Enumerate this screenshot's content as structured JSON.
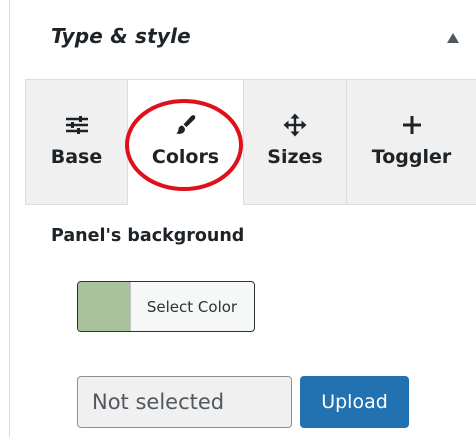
{
  "panel": {
    "title": "Type & style",
    "collapse_icon": "triangle-up-icon"
  },
  "tabs": [
    {
      "label": "Base",
      "icon": "sliders-icon",
      "active": false
    },
    {
      "label": "Colors",
      "icon": "paintbrush-icon",
      "active": true
    },
    {
      "label": "Sizes",
      "icon": "move-arrows-icon",
      "active": false
    },
    {
      "label": "Toggler",
      "icon": "plus-icon",
      "active": false
    }
  ],
  "annotation": {
    "shape": "ellipse",
    "target": "Colors",
    "color": "#e0101b"
  },
  "background_setting": {
    "label": "Panel's background",
    "color_button_label": "Select Color",
    "swatch_color": "#a9c29b"
  },
  "upload": {
    "field_value": "Not selected",
    "button_label": "Upload"
  },
  "colors": {
    "tab_inactive_bg": "#f0f0f1",
    "border": "#dcdcde",
    "primary": "#2271b1",
    "text": "#1d2327"
  }
}
